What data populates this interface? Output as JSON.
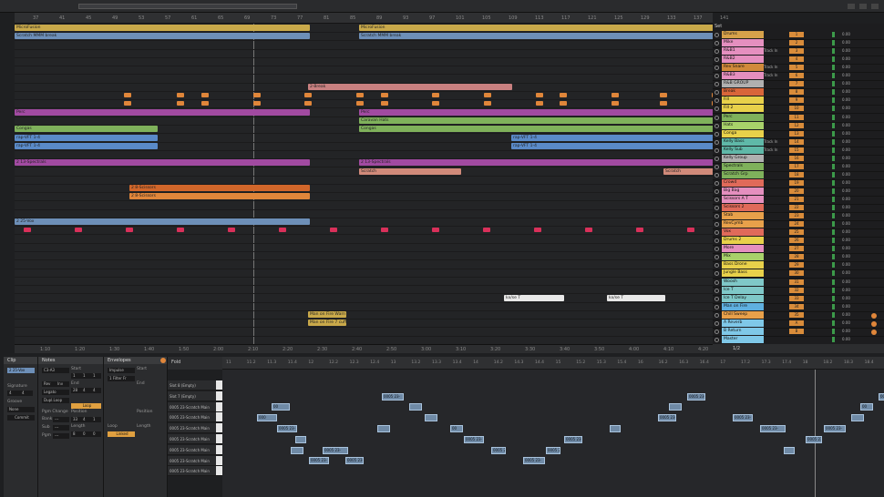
{
  "ruler_labels": [
    "37",
    "41",
    "45",
    "49",
    "53",
    "57",
    "61",
    "65",
    "69",
    "73",
    "77",
    "81",
    "85",
    "89",
    "93",
    "97",
    "101",
    "105",
    "109",
    "113",
    "117",
    "121",
    "125",
    "129",
    "133",
    "137",
    "141"
  ],
  "bottom_ruler_labels": [
    "1:10",
    "1:20",
    "1:30",
    "1:40",
    "1:50",
    "2:00",
    "2:10",
    "2:20",
    "2:30",
    "2:40",
    "2:50",
    "3:00",
    "3:10",
    "3:20",
    "3:30",
    "3:40",
    "3:50",
    "4:00",
    "4:10",
    "4:20"
  ],
  "set_label": "Set",
  "arrangement_clips": [
    {
      "row": 0,
      "segments": [
        {
          "label": "MicroFusion",
          "color": "#c9a94a"
        },
        {
          "label": "MicroFusion",
          "color": "#c9a94a"
        }
      ]
    },
    {
      "row": 1,
      "segments": [
        {
          "label": "Scratch MMM break",
          "color": "#6d8fb8"
        },
        {
          "label": "Scratch MMM break",
          "color": "#6d8fb8"
        }
      ]
    },
    {
      "row": 7,
      "segments": [
        {
          "label": "2-Break",
          "color": "#c98080"
        }
      ]
    },
    {
      "row": 10,
      "segments": [
        {
          "label": "Perc",
          "color": "#a14aa1"
        },
        {
          "label": "Perc",
          "color": "#a14aa1"
        }
      ]
    },
    {
      "row": 11,
      "segments": [
        {
          "label": "Caravan Hats",
          "color": "#7fb15b"
        }
      ]
    },
    {
      "row": 12,
      "segments": [
        {
          "label": "Congas",
          "color": "#7fb15b"
        },
        {
          "label": "Congas",
          "color": "#7fb15b"
        }
      ]
    },
    {
      "row": 13,
      "segments": [
        {
          "label": "rap-VFT 1-4",
          "color": "#5a8ac8"
        },
        {
          "label": "rap-VFT 1-4",
          "color": "#5a8ac8"
        }
      ]
    },
    {
      "row": 14,
      "segments": [
        {
          "label": "rap-VFT 1-4",
          "color": "#5a8ac8"
        },
        {
          "label": "rap-VFT 1-4",
          "color": "#5a8ac8"
        }
      ]
    },
    {
      "row": 16,
      "segments": [
        {
          "label": "2 13-Spectrals",
          "color": "#a14aa1"
        },
        {
          "label": "2 13-Spectrals",
          "color": "#a14aa1"
        }
      ]
    },
    {
      "row": 17,
      "segments": [
        {
          "label": "Scratch",
          "color": "#d18a7a"
        },
        {
          "label": "Scratch",
          "color": "#d18a7a"
        }
      ]
    },
    {
      "row": 19,
      "segments": [
        {
          "label": "2 8-Scissors",
          "color": "#d1662a"
        }
      ]
    },
    {
      "row": 20,
      "segments": [
        {
          "label": "2 8-Scissors",
          "color": "#e0863a"
        }
      ]
    },
    {
      "row": 23,
      "segments": [
        {
          "label": "2 25-Vox",
          "color": "#6d8fb8"
        }
      ]
    },
    {
      "row": 32,
      "segments": [
        {
          "label": "kx/se T",
          "color": "#e8e8e8"
        },
        {
          "label": "kx/se T",
          "color": "#e8e8e8"
        }
      ]
    },
    {
      "row": 34,
      "segments": [
        {
          "label": "Man on Fire Warn",
          "color": "#c9a94a"
        }
      ]
    },
    {
      "row": 35,
      "segments": [
        {
          "label": "Man on Fire 7 cuff",
          "color": "#c9a94a"
        }
      ]
    }
  ],
  "tracks": [
    {
      "name": "Drums",
      "color": "#d6a14a",
      "num": "1",
      "input": "",
      "vol": "0.00"
    },
    {
      "name": "Mike",
      "color": "#e58fbf",
      "num": "2",
      "input": "",
      "vol": "0.00"
    },
    {
      "name": "R&B1",
      "color": "#e58fbf",
      "num": "3",
      "input": "Track In",
      "vol": "0.00"
    },
    {
      "name": "R&B2",
      "color": "#e58fbf",
      "num": "4",
      "input": "",
      "vol": "0.00"
    },
    {
      "name": "Rev Snare",
      "color": "#d18a3a",
      "num": "5",
      "input": "Track In",
      "vol": "0.00"
    },
    {
      "name": "R&B3",
      "color": "#e58fbf",
      "num": "6",
      "input": "Track In",
      "vol": "0.00"
    },
    {
      "name": "R&B GROUP",
      "color": "#b0b0b0",
      "num": "7",
      "input": "",
      "vol": "0.00"
    },
    {
      "name": "Break",
      "color": "#d9663a",
      "num": "8",
      "input": "",
      "vol": "0.00"
    },
    {
      "name": "Fill",
      "color": "#e8d14a",
      "num": "9",
      "input": "",
      "vol": "0.00"
    },
    {
      "name": "Fill 2",
      "color": "#e8d14a",
      "num": "10",
      "input": "",
      "vol": "0.00"
    },
    {
      "name": "Perc",
      "color": "#7fb15b",
      "num": "11",
      "input": "",
      "vol": "0.00"
    },
    {
      "name": "Hats",
      "color": "#a8d16a",
      "num": "12",
      "input": "",
      "vol": "0.00"
    },
    {
      "name": "Conga",
      "color": "#e8d14a",
      "num": "13",
      "input": "",
      "vol": "0.00"
    },
    {
      "name": "Kelly Bass",
      "color": "#5fb8a8",
      "num": "14",
      "input": "Track In",
      "vol": "0.00"
    },
    {
      "name": "Kelly Sub",
      "color": "#5fb8a8",
      "num": "15",
      "input": "Track In",
      "vol": "0.00"
    },
    {
      "name": "Kelly Group",
      "color": "#b0b0b0",
      "num": "16",
      "input": "",
      "vol": "0.00"
    },
    {
      "name": "Spectrals",
      "color": "#7fb15b",
      "num": "17",
      "input": "",
      "vol": "0.00"
    },
    {
      "name": "Scratch Grp",
      "color": "#7fb15b",
      "num": "18",
      "input": "",
      "vol": "0.00"
    },
    {
      "name": "Crowd",
      "color": "#e06a5a",
      "num": "19",
      "input": "",
      "vol": "0.00"
    },
    {
      "name": "Big Bag",
      "color": "#e58fbf",
      "num": "20",
      "input": "",
      "vol": "0.00"
    },
    {
      "name": "Scissors A T",
      "color": "#e58fbf",
      "num": "21",
      "input": "",
      "vol": "0.00"
    },
    {
      "name": "Scissors 2",
      "color": "#e06a5a",
      "num": "22",
      "input": "",
      "vol": "0.00"
    },
    {
      "name": "Stab",
      "color": "#e8a04a",
      "num": "23",
      "input": "",
      "vol": "0.00"
    },
    {
      "name": "RevCymb",
      "color": "#e8a04a",
      "num": "24",
      "input": "",
      "vol": "0.00"
    },
    {
      "name": "Vox",
      "color": "#e06a5a",
      "num": "25",
      "input": "",
      "vol": "0.00"
    },
    {
      "name": "Drums 2",
      "color": "#e8d14a",
      "num": "26",
      "input": "",
      "vol": "0.00"
    },
    {
      "name": "More",
      "color": "#e58fbf",
      "num": "27",
      "input": "",
      "vol": "0.00"
    },
    {
      "name": "Mix",
      "color": "#a8d16a",
      "num": "28",
      "input": "",
      "vol": "0.00"
    },
    {
      "name": "Bass Drone",
      "color": "#e8d14a",
      "num": "29",
      "input": "",
      "vol": "0.00"
    },
    {
      "name": "Jungle Bass",
      "color": "#e8d14a",
      "num": "30",
      "input": "",
      "vol": "0.00"
    },
    {
      "name": "Woosh",
      "color": "#7fc8c8",
      "num": "31",
      "input": "",
      "vol": "0.00"
    },
    {
      "name": "Ice T",
      "color": "#7fc8c8",
      "num": "32",
      "input": "",
      "vol": "0.00"
    },
    {
      "name": "Ice T Delay",
      "color": "#7fc8c8",
      "num": "33",
      "input": "",
      "vol": "0.00"
    },
    {
      "name": "Man on Fire",
      "color": "#5fb0e0",
      "num": "34",
      "input": "",
      "vol": "0.00"
    },
    {
      "name": "Chill Sweep",
      "color": "#e8a04a",
      "num": "35",
      "input": "",
      "vol": "0.00"
    },
    {
      "name": "A Reverb",
      "color": "#7fc8e8",
      "num": "A",
      "input": "",
      "vol": "0.00"
    },
    {
      "name": "B Return",
      "color": "#7fc8e8",
      "num": "B",
      "input": "",
      "vol": "0.00"
    },
    {
      "name": "Master",
      "color": "#7fc8e8",
      "num": "",
      "input": "",
      "vol": "0.00"
    }
  ],
  "master_ratio": "1/2",
  "clip_panel": {
    "title": "Clip",
    "name": "2 25-Vox",
    "signature_label": "Signature",
    "sig_num": "4",
    "sig_den": "4",
    "groove_label": "Groove",
    "groove_value": "None",
    "commit": "Commit"
  },
  "notes_panel": {
    "title": "Notes",
    "key": "C3-A3",
    "start_label": "Start",
    "start_vals": [
      "1",
      "1",
      "1"
    ],
    "end_label": "End",
    "end_vals": [
      "28",
      "4",
      "4"
    ],
    "rev": "Rev",
    "inv": "Inv",
    "legato": "Legato",
    "dupl": "Dupl.Loop",
    "loop_label": "Loop",
    "position_label": "Position",
    "pos_vals": [
      "33",
      "4",
      "1"
    ],
    "length_label": "Length",
    "len_vals": [
      "8",
      "0",
      "0"
    ],
    "pgm_label": "Pgm Change",
    "bank_label": "Bank",
    "sub_label": "Sub",
    "pgm_short": "Pgm",
    "dashes": "---"
  },
  "env_panel": {
    "title": "Envelopes",
    "device": "Impulse",
    "param": "1 Filter Fr",
    "start_label": "Start",
    "end_label": "End",
    "loop_label": "Loop",
    "position_label": "Position",
    "length_label": "Length",
    "linked": "Linked"
  },
  "fold_label": "Fold",
  "piano_ruler": [
    "11",
    "11.2",
    "11.3",
    "11.4",
    "12",
    "12.2",
    "12.3",
    "12.4",
    "13",
    "13.2",
    "13.3",
    "13.4",
    "14",
    "14.2",
    "14.3",
    "14.4",
    "15",
    "15.2",
    "15.3",
    "15.4",
    "16",
    "16.2",
    "16.3",
    "16.4",
    "17",
    "17.2",
    "17.3",
    "17.4",
    "18",
    "18.2",
    "18.3",
    "18.4"
  ],
  "key_rows": [
    "Slot 8 (Empty)",
    "Slot 7 (Empty)",
    "0005 23-Scratch Main",
    "0005 23-Scratch Main",
    "0005 23-Scratch Main",
    "0005 23-Scratch Main",
    "0005 23-Scratch Main",
    "0005 23-Scratch Main",
    "0005 23-Scratch Main"
  ],
  "note_label": "0005 23-",
  "note_label2": "000",
  "note_label3": "00"
}
